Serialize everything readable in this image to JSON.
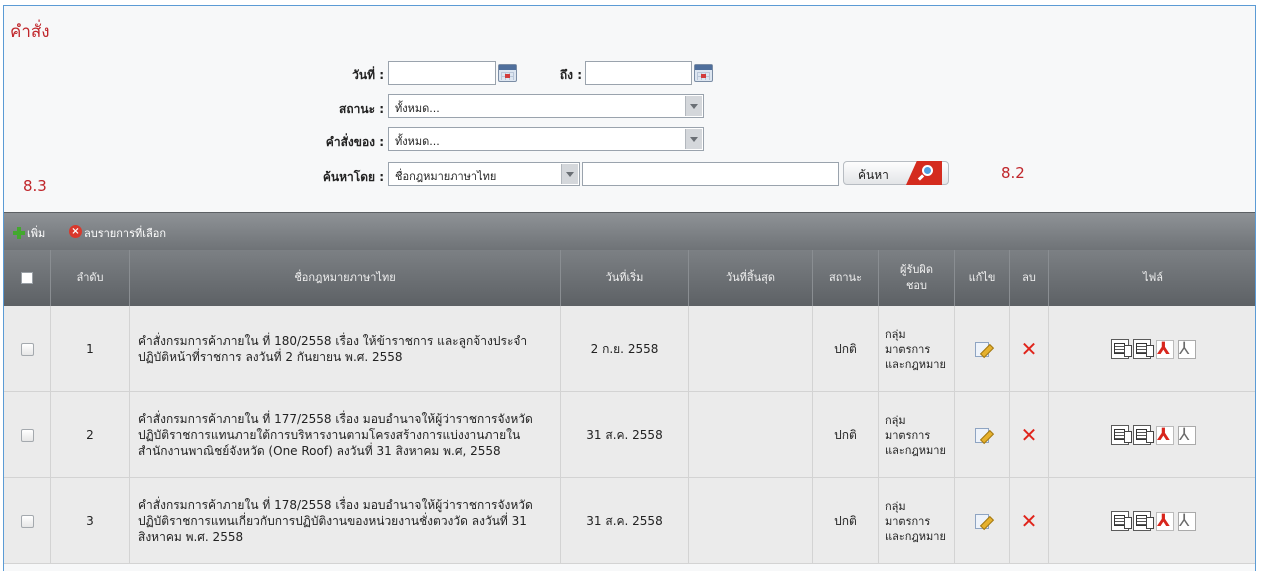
{
  "page_title": "คำสั่ง",
  "filters": {
    "date_label": "วันที่ :",
    "date_from": "",
    "to_label": "ถึง :",
    "date_to": "",
    "status_label": "สถานะ :",
    "status_value": "ทั้งหมด...",
    "owner_label": "คำสั่งของ :",
    "owner_value": "ทั้งหมด...",
    "search_by_label": "ค้นหาโดย :",
    "search_by_value": "ชื่อกฎหมายภาษาไทย",
    "search_text": "",
    "search_button": "ค้นหา"
  },
  "annotations": {
    "left": "8.3",
    "right": "8.2"
  },
  "toolbar": {
    "add": "เพิ่ม",
    "delete_selected": "ลบรายการที่เลือก"
  },
  "columns": [
    "ลำดับ",
    "ชื่อกฎหมายภาษาไทย",
    "วันที่เริ่ม",
    "วันที่สิ้นสุด",
    "สถานะ",
    "ผู้รับผิดชอบ",
    "แก้ไข",
    "ลบ",
    "ไฟล์"
  ],
  "rows": [
    {
      "no": "1",
      "title": "คำสั่งกรมการค้าภายใน ที่ 180/2558 เรื่อง ให้ข้าราชการ และลูกจ้างประจำ ปฏิบัติหน้าที่ราชการ ลงวันที่ 2 กันยายน พ.ศ. 2558",
      "start": "2 ก.ย. 2558",
      "end": "",
      "status": "ปกติ",
      "responsible": "กลุ่มมาตรการและกฎหมาย"
    },
    {
      "no": "2",
      "title": "คำสั่งกรมการค้าภายใน ที่ 177/2558 เรื่อง มอบอำนาจให้ผู้ว่าราชการจังหวัดปฏิบัติราชการแทนภายใต้การบริหารงานตามโครงสร้างการแบ่งงานภายในสำนักงานพาณิชย์จังหวัด (One Roof) ลงวันที่ 31 สิงหาคม พ.ศ, 2558",
      "start": "31 ส.ค. 2558",
      "end": "",
      "status": "ปกติ",
      "responsible": "กลุ่มมาตรการและกฎหมาย"
    },
    {
      "no": "3",
      "title": "คำสั่งกรมการค้าภายใน ที่ 178/2558 เรื่อง มอบอำนาจให้ผู้ว่าราชการจังหวัดปฏิบัติราชการแทนเกี่ยวกับการปฏิบัติงานของหน่วยงานชั่งตวงวัด ลงวันที่ 31 สิงหาคม พ.ศ. 2558",
      "start": "31 ส.ค. 2558",
      "end": "",
      "status": "ปกติ",
      "responsible": "กลุ่มมาตรการและกฎหมาย"
    }
  ]
}
